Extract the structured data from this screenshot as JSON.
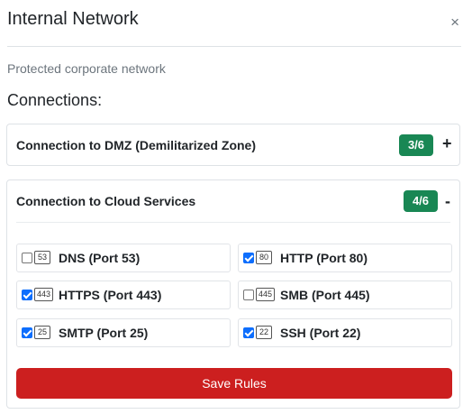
{
  "header": {
    "title": "Internal Network",
    "close_label": "×"
  },
  "description": "Protected corporate network",
  "connections_label": "Connections:",
  "panels": [
    {
      "title": "Connection to DMZ (Demilitarized Zone)",
      "badge": "3/6",
      "toggle": "+",
      "expanded": false
    },
    {
      "title": "Connection to Cloud Services",
      "badge": "4/6",
      "toggle": "-",
      "expanded": true,
      "ports": [
        {
          "number": "53",
          "label": "DNS (Port 53)",
          "checked": false
        },
        {
          "number": "80",
          "label": "HTTP (Port 80)",
          "checked": true
        },
        {
          "number": "443",
          "label": "HTTPS (Port 443)",
          "checked": true
        },
        {
          "number": "445",
          "label": "SMB (Port 445)",
          "checked": false
        },
        {
          "number": "25",
          "label": "SMTP (Port 25)",
          "checked": true
        },
        {
          "number": "22",
          "label": "SSH (Port 22)",
          "checked": true
        }
      ],
      "save_label": "Save Rules"
    }
  ],
  "colors": {
    "badge": "#198754",
    "save_button": "#cc1f1f",
    "checkbox_checked": "#0d6efd"
  }
}
